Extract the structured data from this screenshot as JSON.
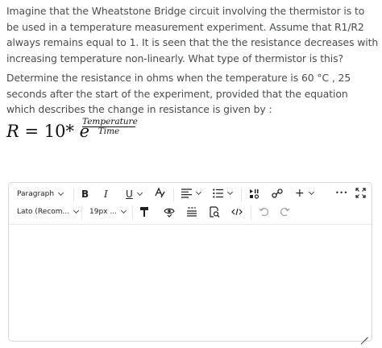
{
  "question": {
    "paragraph1": "Imagine that the Wheatstone Bridge circuit involving the thermistor is to be used in a temperature measurement experiment. Assume that R1/R2 always remains equal to 1. It is seen that the the resistance decreases with increasing temperature non-linearly. What type of thermistor is this?",
    "paragraph2": "Determine the resistance in ohms when the temperature is 60 °C , 25 seconds after the start of the experiment, provided that the equation which describes the change in resistance is given by :"
  },
  "formula": {
    "lhs": "R",
    "equals": " = ",
    "coefficient": "10* ",
    "base": "e",
    "numerator": "Temperature",
    "denominator": "Time"
  },
  "editor": {
    "block_format": "Paragraph",
    "font_family": "Lato (Recom...",
    "font_size": "19px ...",
    "bold": "B",
    "italic": "I",
    "underline": "U",
    "insert": "+",
    "more": "•••"
  }
}
